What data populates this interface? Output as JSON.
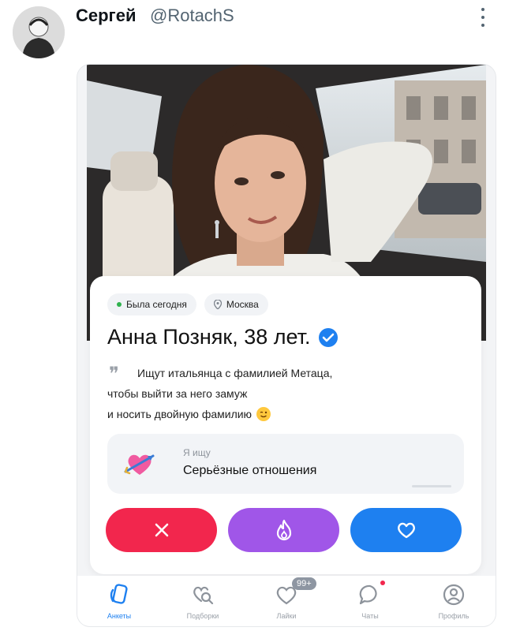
{
  "tweet": {
    "author_name": "Сергей",
    "author_handle": "@RotachS"
  },
  "profile": {
    "status": "Была сегодня",
    "city": "Москва",
    "name_age": "Анна Позняк, 38 лет.",
    "bio_lines": [
      "Ищут итальянца с фамилией Метаца,",
      "чтобы выйти за него замуж",
      "и носить двойную фамилию"
    ],
    "seeking_label": "Я ищу",
    "seeking_value": "Серьёзные отношения"
  },
  "colors": {
    "dislike": "#f2264d",
    "super": "#a056e8",
    "like": "#1e80f0",
    "verified": "#1e80f0",
    "online": "#2fb24d"
  },
  "nav": {
    "items": [
      {
        "label": "Анкеты",
        "icon": "cards-icon",
        "active": true
      },
      {
        "label": "Подборки",
        "icon": "heart-search-icon"
      },
      {
        "label": "Лайки",
        "icon": "heart-bubble-icon",
        "badge": "99+"
      },
      {
        "label": "Чаты",
        "icon": "chat-icon",
        "dot": true
      },
      {
        "label": "Профиль",
        "icon": "profile-icon"
      }
    ]
  }
}
